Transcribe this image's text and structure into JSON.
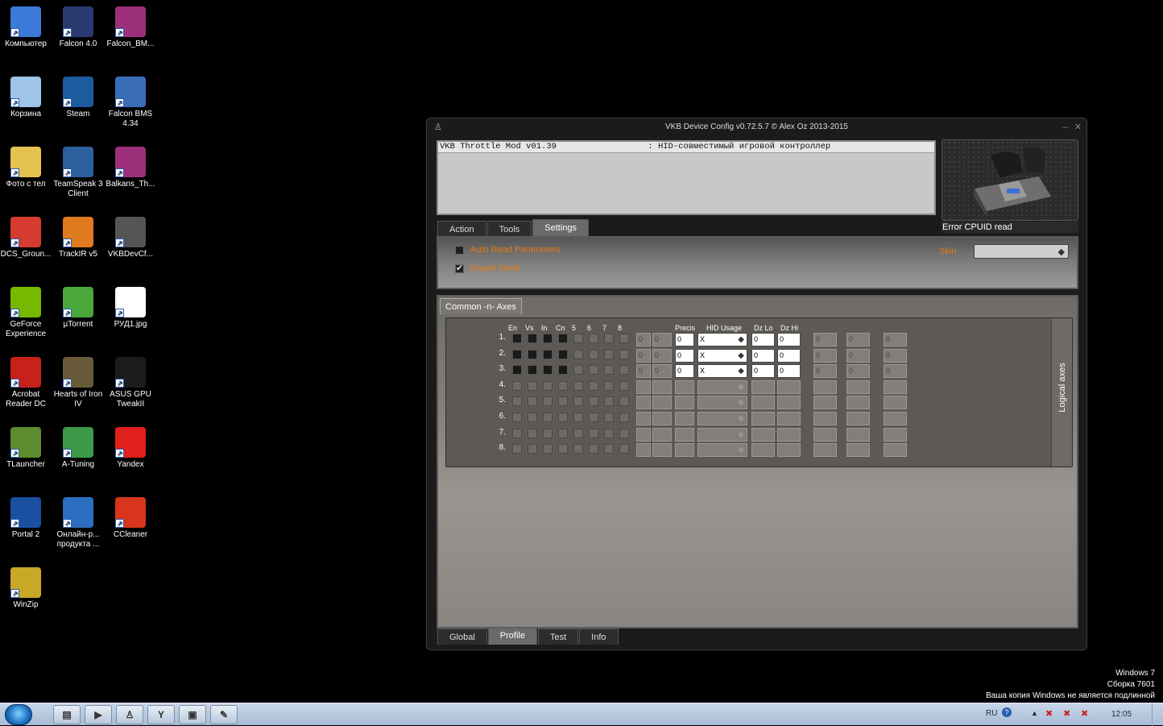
{
  "desktop": {
    "icons": [
      {
        "label": "Компьютер",
        "icon": "computer-icon",
        "color": "#3b7ad8"
      },
      {
        "label": "Falcon 4.0",
        "icon": "falcon-icon",
        "color": "#2a3a70"
      },
      {
        "label": "Falcon_BM...",
        "icon": "winrar-archive-icon",
        "color": "#9b2f7a"
      },
      {
        "label": "Корзина",
        "icon": "recycle-bin-icon",
        "color": "#9ec4e8"
      },
      {
        "label": "Steam",
        "icon": "steam-icon",
        "color": "#1e5a9e"
      },
      {
        "label": "Falcon BMS\n4.34",
        "icon": "falcon-bms-icon",
        "color": "#3a6fb8"
      },
      {
        "label": "Фото с тел",
        "icon": "folder-icon",
        "color": "#e3c34d"
      },
      {
        "label": "TeamSpeak 3\nClient",
        "icon": "teamspeak-icon",
        "color": "#2c5f9e"
      },
      {
        "label": "Balkans_Th...",
        "icon": "winrar-archive-icon",
        "color": "#9b2f7a"
      },
      {
        "label": "DCS_Groun...",
        "icon": "pdf-icon",
        "color": "#d63b2f"
      },
      {
        "label": "TrackIR v5",
        "icon": "trackir-icon",
        "color": "#e07a1f"
      },
      {
        "label": "VKBDevCf...",
        "icon": "joystick-icon",
        "color": "#555555"
      },
      {
        "label": "GeForce\nExperience",
        "icon": "nvidia-icon",
        "color": "#76b900"
      },
      {
        "label": "µTorrent",
        "icon": "utorrent-icon",
        "color": "#4aa83a"
      },
      {
        "label": "РУД1.jpg",
        "icon": "image-file-icon",
        "color": "#ffffff"
      },
      {
        "label": "Acrobat\nReader DC",
        "icon": "acrobat-icon",
        "color": "#c8211b"
      },
      {
        "label": "Hearts of Iron\nIV",
        "icon": "hoi4-icon",
        "color": "#6a5a3a"
      },
      {
        "label": "ASUS GPU\nTweakII",
        "icon": "asus-gpu-icon",
        "color": "#1c1c1c"
      },
      {
        "label": "TLauncher",
        "icon": "minecraft-icon",
        "color": "#5d8c2e"
      },
      {
        "label": "A-Tuning",
        "icon": "a-tuning-icon",
        "color": "#3c9a4a"
      },
      {
        "label": "Yandex",
        "icon": "yandex-icon",
        "color": "#e0201b"
      },
      {
        "label": "Portal 2",
        "icon": "portal2-icon",
        "color": "#1b4fa0"
      },
      {
        "label": "Онлайн-р...\nпродукта ...",
        "icon": "asus-icon",
        "color": "#2c6ec0"
      },
      {
        "label": "CCleaner",
        "icon": "ccleaner-icon",
        "color": "#d8351c"
      },
      {
        "label": "WinZip",
        "icon": "winzip-icon",
        "color": "#c9a826"
      }
    ]
  },
  "window": {
    "title": "VKB Device Config v0.72.5.7 © Alex Oz 2013-2015",
    "device_row": "VKB Throttle Mod v01.39                  : HID-совместимый игровой контроллер",
    "cpuid_text": "Error CPUID read",
    "top_tabs": [
      "Action",
      "Tools",
      "Settings"
    ],
    "active_top_tab": "Settings",
    "settings": {
      "auto_read_label": "Auto Read Parameters",
      "auto_read_checked": false,
      "expert_mode_label": "Expert Mode",
      "expert_mode_checked": true,
      "skin_label": "Skin",
      "skin_value": ""
    },
    "axes": {
      "tab_label": "Common -n- Axes",
      "side_label": "Logical axes",
      "headers": {
        "en": "En",
        "vs": "Vs",
        "in": "In",
        "cn": "Cn",
        "c5": "5",
        "c6": "6",
        "c7": "7",
        "c8": "8",
        "precis": "Precis",
        "hid_usage": "HID Usage",
        "dz_lo": "Dz Lo",
        "dz_hi": "Dz Hi"
      },
      "rows": [
        {
          "num": "1.",
          "active": true,
          "f1": "0",
          "f2": "0",
          "precis": "0",
          "usage": "X",
          "dzlo": "0",
          "dzhi": "0",
          "e1": "0",
          "e2": "0",
          "e3": "0"
        },
        {
          "num": "2.",
          "active": true,
          "f1": "0",
          "f2": "0",
          "precis": "0",
          "usage": "X",
          "dzlo": "0",
          "dzhi": "0",
          "e1": "0",
          "e2": "0",
          "e3": "0"
        },
        {
          "num": "3.",
          "active": true,
          "f1": "0",
          "f2": "0",
          "precis": "0",
          "usage": "X",
          "dzlo": "0",
          "dzhi": "0",
          "e1": "0",
          "e2": "0",
          "e3": "0"
        },
        {
          "num": "4.",
          "active": false
        },
        {
          "num": "5.",
          "active": false
        },
        {
          "num": "6.",
          "active": false
        },
        {
          "num": "7.",
          "active": false
        },
        {
          "num": "8.",
          "active": false
        }
      ]
    },
    "bottom_tabs": [
      "Global",
      "Profile",
      "Test",
      "Info"
    ],
    "active_bottom_tab": "Profile"
  },
  "taskbar": {
    "items": [
      {
        "icon": "explorer-icon",
        "glyph": "▤"
      },
      {
        "icon": "media-player-icon",
        "glyph": "▶"
      },
      {
        "icon": "vkb-joystick-icon",
        "glyph": "♙"
      },
      {
        "icon": "yandex-browser-icon",
        "glyph": "Y"
      },
      {
        "icon": "nvidia-icon",
        "glyph": "▣"
      },
      {
        "icon": "paint-icon",
        "glyph": "✎"
      }
    ],
    "lang": "RU",
    "time": "12:05"
  },
  "watermark": {
    "line1": "Windows 7",
    "line2": "Сборка 7601",
    "line3": "Ваша копия Windows не является подлинной"
  }
}
